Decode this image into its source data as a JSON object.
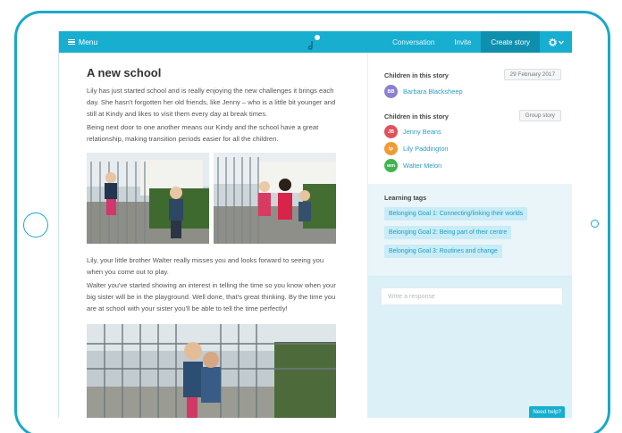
{
  "topbar": {
    "menu_label": "Menu",
    "nav": [
      "Conversation",
      "Invite",
      "Create story"
    ],
    "active_nav": "Create story"
  },
  "story": {
    "title": "A new school",
    "paragraphs": [
      "Lily has just started school and is really enjoying the new challenges it brings each day. She hasn't forgotten her old friends, like Jenny – who is a little bit younger and still at Kindy and likes to visit them every day at break times.",
      "Being next door to one another means our Kindy and the school have a great relationship, making transition periods easier for all the children.",
      "Lily, your little brother Walter really misses you and looks forward to seeing you when you come out to play.",
      "Walter you've started showing an interest in telling the time so you know when your big sister will be in the playground. Well done, that's great thinking. By the time you are at school with your sister you'll be able to tell the time perfectly!"
    ]
  },
  "panel": {
    "children_label_1": "Children in this story",
    "date": "29 February 2017",
    "primary_child": {
      "initials": "BB",
      "name": "Barbara Blacksheep",
      "color": "#8b7fd1"
    },
    "children_label_2": "Children in this story",
    "group_story_label": "Group story",
    "children": [
      {
        "initials": "JB",
        "name": "Jenny Beans",
        "color": "#e0515a"
      },
      {
        "initials": "lp",
        "name": "Lily Paddington",
        "color": "#f39a34"
      },
      {
        "initials": "wm",
        "name": "Walter Melon",
        "color": "#3fb44f"
      }
    ],
    "learning_tags_label": "Learning tags",
    "tags": [
      "Belonging Goal 1: Connecting/linking their worlds",
      "Belonging Goal 2: Being part of their centre",
      "Belonging Goal 3: Routines and change"
    ],
    "response_placeholder": "Write a response",
    "help_label": "Need help?"
  },
  "colors": {
    "brand": "#17aed0",
    "brand_dark": "#0e8fae",
    "tag_bg": "#c9ecf6",
    "link": "#2a9dc6"
  },
  "icons": [
    "hamburger-icon",
    "app-logo-icon",
    "gear-icon",
    "chevron-down-icon"
  ]
}
